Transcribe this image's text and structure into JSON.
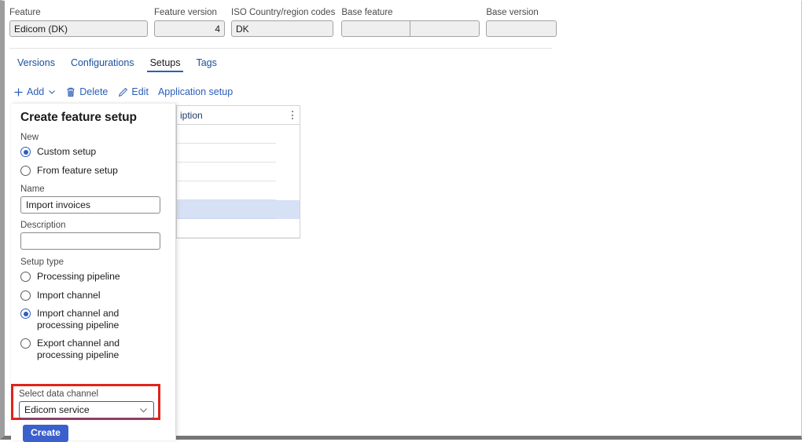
{
  "header": {
    "fields": [
      {
        "label": "Feature",
        "value": "Edicom (DK)",
        "align": "left"
      },
      {
        "label": "Feature version",
        "value": "4",
        "align": "right"
      },
      {
        "label": "ISO Country/region codes",
        "value": "DK",
        "align": "left"
      },
      {
        "label": "Base feature",
        "value": "",
        "value2": "",
        "align": "left",
        "pair": true
      },
      {
        "label": "Base version",
        "value": "",
        "align": "left"
      }
    ]
  },
  "tabs": [
    {
      "label": "Versions",
      "active": false
    },
    {
      "label": "Configurations",
      "active": false
    },
    {
      "label": "Setups",
      "active": true
    },
    {
      "label": "Tags",
      "active": false
    }
  ],
  "toolbar": {
    "add_label": "Add",
    "add_icon": "plus-icon",
    "add_caret_icon": "chevron-down-icon",
    "delete_label": "Delete",
    "delete_icon": "trash-icon",
    "edit_label": "Edit",
    "edit_icon": "pencil-icon",
    "application_setup_label": "Application setup"
  },
  "grid": {
    "column_header": "iption",
    "overflow_menu_icon": "vertical-dots-icon",
    "rows": [
      {
        "selected": false
      },
      {
        "selected": false
      },
      {
        "selected": false
      },
      {
        "selected": false
      },
      {
        "selected": true
      },
      {
        "selected": false
      }
    ]
  },
  "dialog": {
    "title": "Create feature setup",
    "new_group_label": "New",
    "new_options": [
      {
        "label": "Custom setup",
        "checked": true
      },
      {
        "label": "From feature setup",
        "checked": false
      }
    ],
    "name_label": "Name",
    "name_value": "Import invoices",
    "name_placeholder": "",
    "description_label": "Description",
    "description_value": "",
    "description_placeholder": "",
    "setup_type_label": "Setup type",
    "setup_type_options": [
      {
        "label": "Processing pipeline",
        "checked": false
      },
      {
        "label": "Import channel",
        "checked": false
      },
      {
        "label": "Import channel and processing pipeline",
        "checked": true
      },
      {
        "label": "Export channel and processing pipeline",
        "checked": false
      }
    ],
    "channel_label": "Select data channel",
    "channel_value": "Edicom service",
    "channel_caret_icon": "chevron-down-icon",
    "create_label": "Create"
  },
  "colors": {
    "accent": "#2b5fb8",
    "link": "#2b5fb8",
    "highlight_border": "#e1231c",
    "primary_button": "#3b5fcc",
    "row_selected": "#d6e1f5"
  }
}
